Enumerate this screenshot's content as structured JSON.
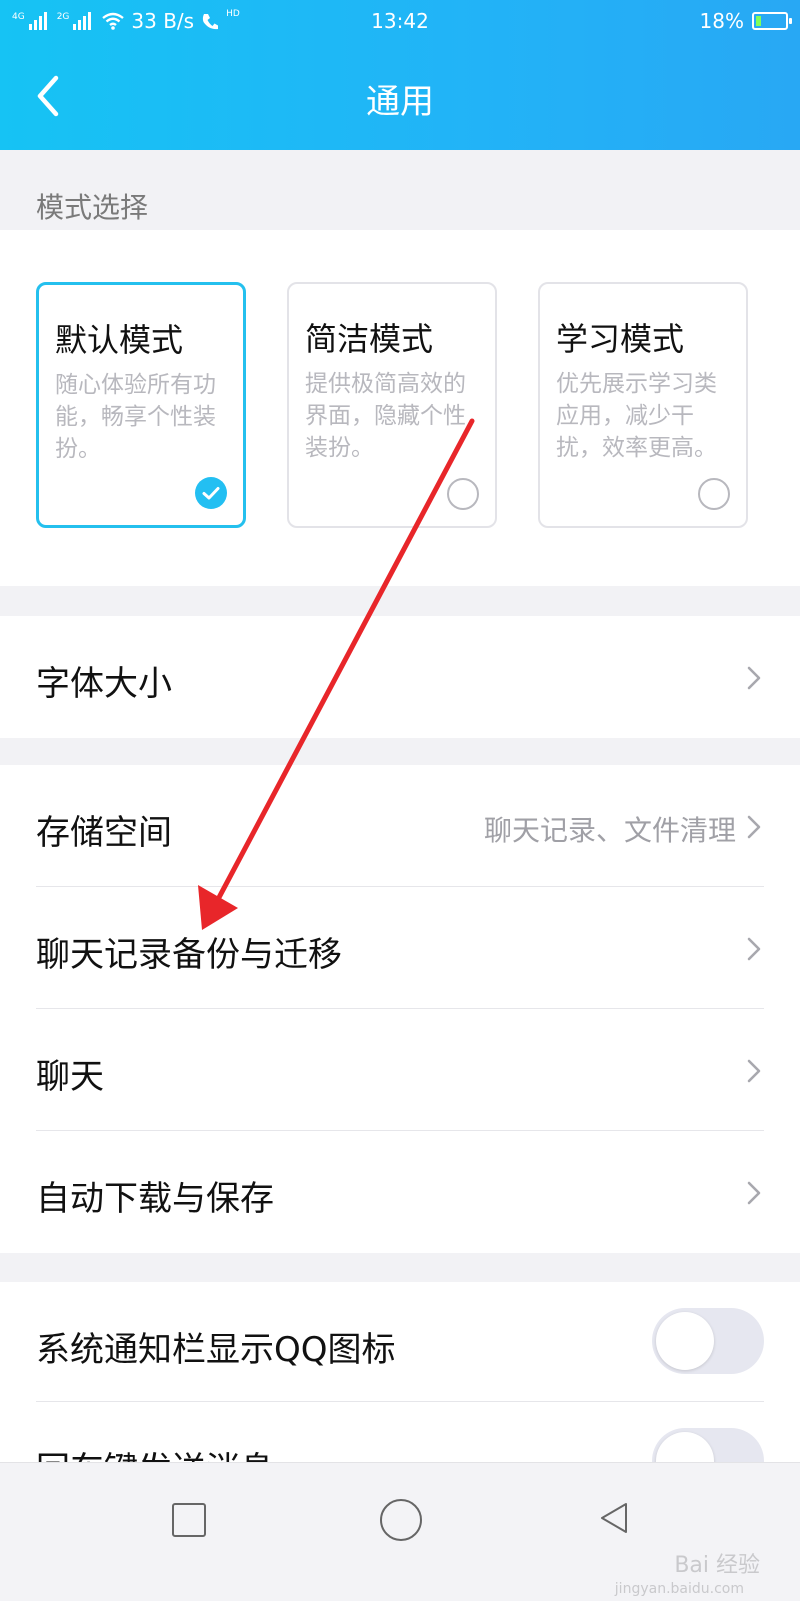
{
  "status_bar": {
    "net_1": "4G",
    "net_2": "2G",
    "speed": "33 B/s",
    "hd": "HD",
    "time": "13:42",
    "battery": "18%",
    "battery_level": 0.18
  },
  "header": {
    "title": "通用"
  },
  "modes": {
    "section_label": "模式选择",
    "cards": [
      {
        "title": "默认模式",
        "desc": "随心体验所有功能，畅享个性装扮。",
        "selected": true
      },
      {
        "title": "简洁模式",
        "desc": "提供极简高效的界面，隐藏个性装扮。",
        "selected": false
      },
      {
        "title": "学习模式",
        "desc": "优先展示学习类应用，减少干扰，效率更高。",
        "selected": false
      }
    ]
  },
  "rows": {
    "font_size": "字体大小",
    "storage": "存储空间",
    "storage_value": "聊天记录、文件清理",
    "backup": "聊天记录备份与迁移",
    "chat": "聊天",
    "auto_download": "自动下载与保存",
    "notify_icon": "系统通知栏显示QQ图标",
    "enter_send": "回车键发送消息"
  },
  "toggles": {
    "notify_icon": false,
    "enter_send": false
  },
  "watermark": {
    "text": "Bai 经验",
    "sub": "jingyan.baidu.com"
  },
  "colors": {
    "accent": "#23bff2",
    "annotation_arrow": "#e8262a"
  }
}
